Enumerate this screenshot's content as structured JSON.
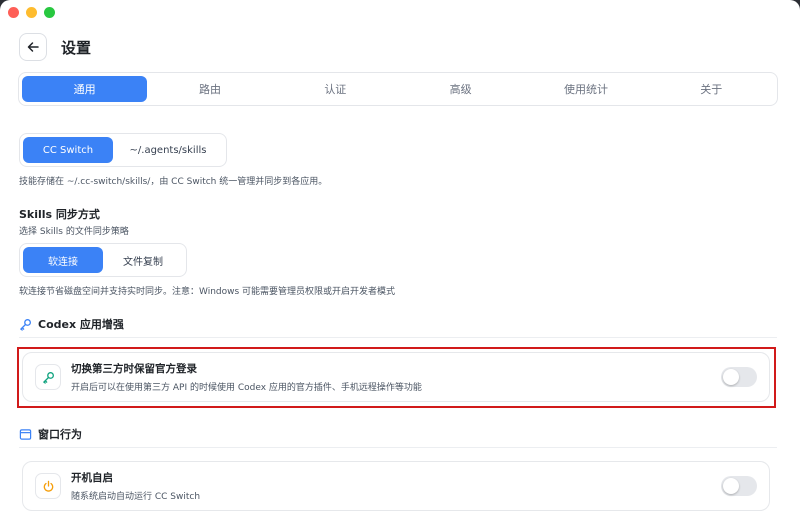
{
  "header": {
    "title": "设置"
  },
  "tabs": [
    {
      "label": "通用",
      "active": true
    },
    {
      "label": "路由",
      "active": false
    },
    {
      "label": "认证",
      "active": false
    },
    {
      "label": "高级",
      "active": false
    },
    {
      "label": "使用统计",
      "active": false
    },
    {
      "label": "关于",
      "active": false
    }
  ],
  "skills_storage": {
    "options": [
      "CC Switch",
      "~/.agents/skills"
    ],
    "selected": "CC Switch",
    "note": "技能存储在 ~/.cc-switch/skills/，由 CC Switch 统一管理并同步到各应用。"
  },
  "skills_sync": {
    "title": "Skills 同步方式",
    "subtitle": "选择 Skills 的文件同步策略",
    "options": [
      "软连接",
      "文件复制"
    ],
    "selected": "软连接",
    "note": "软连接节省磁盘空间并支持实时同步。注意：Windows 可能需要管理员权限或开启开发者模式"
  },
  "codex_section": {
    "title": "Codex 应用增强",
    "icon": "key-icon",
    "setting": {
      "title": "切换第三方时保留官方登录",
      "description": "开启后可以在使用第三方 API 的时候使用 Codex 应用的官方插件、手机远程操作等功能",
      "enabled": false
    }
  },
  "window_section": {
    "title": "窗口行为",
    "icon": "window-icon",
    "setting": {
      "title": "开机自启",
      "description": "随系统启动自动运行 CC Switch",
      "enabled": false
    }
  },
  "colors": {
    "accent": "#3b82f6",
    "highlight": "#d11a1a"
  }
}
